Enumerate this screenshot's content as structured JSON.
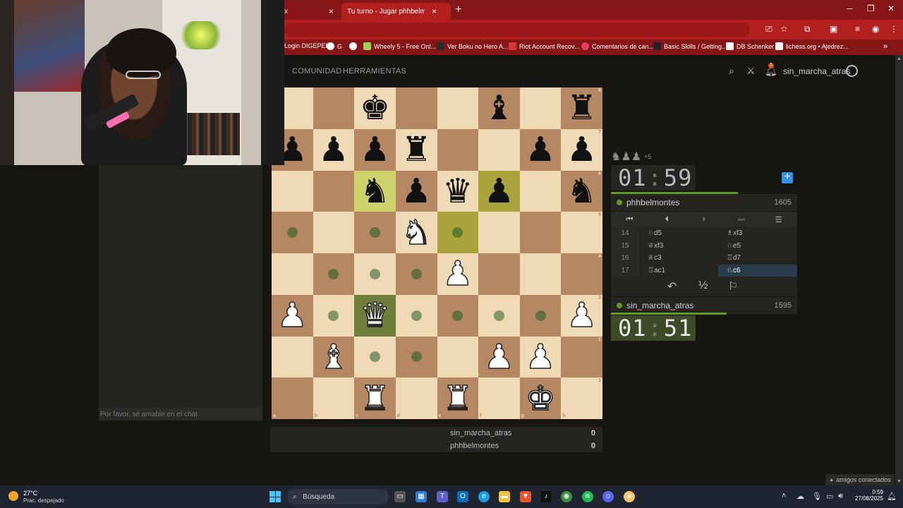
{
  "browser": {
    "tabs": [
      {
        "label": "x",
        "active": false
      },
      {
        "label": "Tu turno - Jugar phhbelmontes",
        "active": true
      }
    ],
    "bookmarks": [
      {
        "label": "Login DIGEPEP",
        "color": "#3b6fc9"
      },
      {
        "label": "G",
        "color": "#ffffff"
      },
      {
        "label": "",
        "color": "#ffffff"
      },
      {
        "label": "Wheely 5 - Free Onl...",
        "color": "#9bd05a"
      },
      {
        "label": "Ver Boku no Hero A...",
        "color": "#2b2b2b"
      },
      {
        "label": "Riot Account Recov...",
        "color": "#d13639"
      },
      {
        "label": "Comentarios de can...",
        "color": "#e53a6a"
      },
      {
        "label": "Basic Skills / Getting...",
        "color": "#222222"
      },
      {
        "label": "DB Schenker",
        "color": "#ffffff"
      },
      {
        "label": "lichess.org • Ajedrez...",
        "color": "#ffffff"
      }
    ]
  },
  "site": {
    "nav": [
      "COMUNIDAD",
      "HERRAMIENTAS"
    ],
    "username": "sin_marcha_atras",
    "notifications": "1"
  },
  "chat": {
    "placeholder": "Por favor, sé amable en el chat"
  },
  "board": {
    "files": [
      "a",
      "b",
      "c",
      "d",
      "e",
      "f",
      "g",
      "h"
    ],
    "ranks": [
      "8",
      "7",
      "6",
      "5",
      "4",
      "3",
      "2",
      "1"
    ],
    "rows": [
      [
        "",
        "",
        "bk",
        "",
        "",
        "bb",
        "",
        "br"
      ],
      [
        "bp",
        "bp",
        "bp",
        "br",
        "",
        "",
        "bp",
        "bp"
      ],
      [
        "",
        "",
        "bn",
        "bp",
        "bq",
        "bp",
        "",
        "bn"
      ],
      [
        "",
        "",
        "",
        "wn",
        "",
        "",
        "",
        ""
      ],
      [
        "",
        "",
        "",
        "",
        "wp",
        "",
        "",
        ""
      ],
      [
        "wp",
        "",
        "wq",
        "",
        "",
        "",
        "",
        "wp"
      ],
      [
        "",
        "wb",
        "",
        "",
        "",
        "wp",
        "wp",
        ""
      ],
      [
        "",
        "",
        "wr",
        "",
        "wr",
        "",
        "wk",
        ""
      ]
    ],
    "dots": [
      "a5",
      "c5",
      "e5",
      "b4",
      "c4",
      "d4",
      "b3",
      "d3",
      "e3",
      "f3",
      "g3",
      "c2",
      "d2"
    ],
    "lastmove": [
      "c6",
      "f6"
    ],
    "selected": "c3",
    "highlight": "e5"
  },
  "opponent": {
    "name": "phhbelmontes",
    "rating": "1605",
    "clock_min": "01",
    "clock_sec": "59",
    "material_plus": "+5",
    "time_fraction": 0.68
  },
  "player": {
    "name": "sin_marcha_atras",
    "rating": "1595",
    "clock_min": "01",
    "clock_sec": "51",
    "time_fraction": 0.62
  },
  "moves": [
    {
      "num": "14",
      "white": "♘d5",
      "black": "♗xf3"
    },
    {
      "num": "15",
      "white": "♕xf3",
      "black": "♘e5"
    },
    {
      "num": "16",
      "white": "♕c3",
      "black": "♖d7"
    },
    {
      "num": "17",
      "white": "♖ac1",
      "black": "♘c6"
    }
  ],
  "controls": {
    "takeback": "↶",
    "draw": "½",
    "resign": "⚐"
  },
  "crosstable": [
    {
      "name": "sin_marcha_atras",
      "score": "0"
    },
    {
      "name": "phhbelmontes",
      "score": "0"
    }
  ],
  "friends": "amigos conectados",
  "taskbar": {
    "temp": "27°C",
    "weather": "Prac. despejado",
    "search": "Búsqueda",
    "time": "0:59",
    "date": "27/08/2025"
  }
}
